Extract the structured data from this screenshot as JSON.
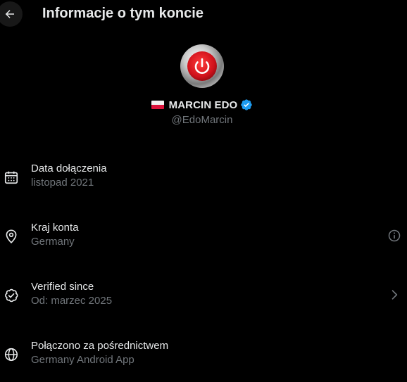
{
  "header": {
    "title": "Informacje o tym koncie",
    "back_icon": "arrow-left-icon"
  },
  "profile": {
    "avatar_icon": "power-button-icon",
    "flag": "poland-flag",
    "display_name": "MARCIN EDO",
    "verified_icon": "verified-badge-icon",
    "handle": "@EdoMarcin"
  },
  "rows": [
    {
      "icon": "calendar-icon",
      "label": "Data dołączenia",
      "value": "listopad 2021"
    },
    {
      "icon": "location-pin-icon",
      "label": "Kraj konta",
      "value": "Germany",
      "trailing_icon": "info-icon"
    },
    {
      "icon": "verified-check-icon",
      "label": "Verified since",
      "value": "Od: marzec 2025",
      "trailing_icon": "chevron-right-icon"
    },
    {
      "icon": "globe-icon",
      "label": "Połączono za pośrednictwem",
      "value": "Germany Android App"
    }
  ],
  "colors": {
    "background": "#000000",
    "primary_text": "#e7e9ea",
    "secondary_text": "#71767b",
    "verified_blue": "#1d9bf0",
    "avatar_red": "#d0121b"
  }
}
